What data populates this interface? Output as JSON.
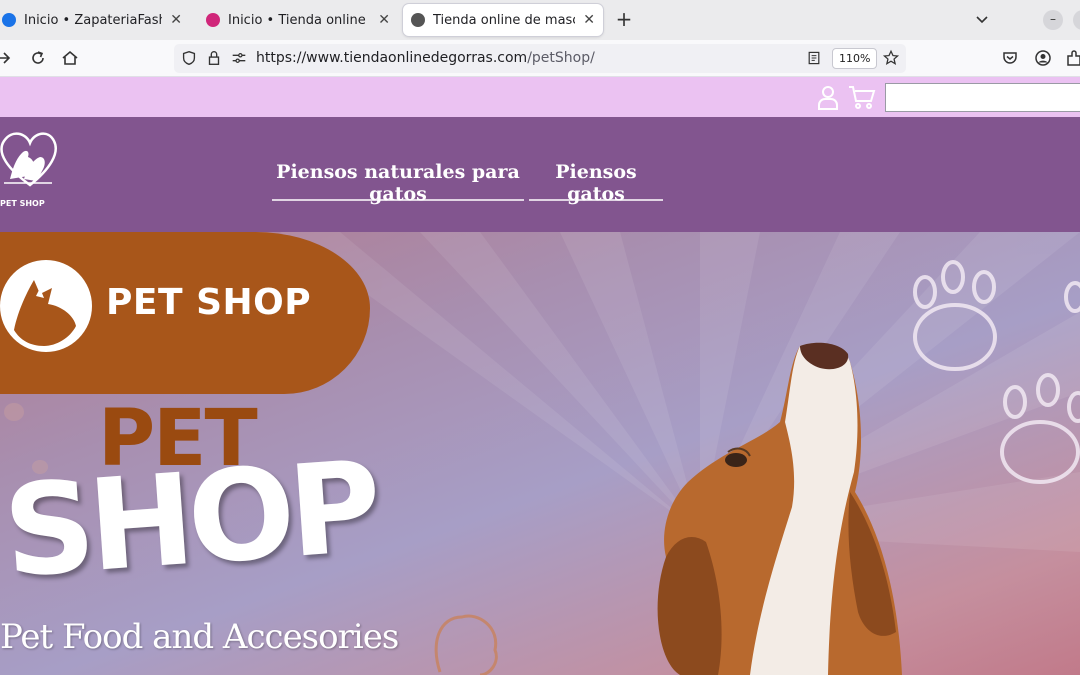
{
  "browser": {
    "tabs": [
      {
        "title": "Inicio • ZapateriaFashion",
        "favicon_color": "#1a73e8",
        "active": false
      },
      {
        "title": "Inicio • Tienda online de m",
        "favicon_color": "#d0267a",
        "active": false
      },
      {
        "title": "Tienda online de mascota",
        "favicon_color": "#555555",
        "active": true
      }
    ],
    "new_tab_label": "+",
    "url_host": "https://www.tiendaonlinedegorras.com",
    "url_path": "/petShop/",
    "zoom": "110%"
  },
  "site": {
    "logo_text": "PET SHOP",
    "menu": [
      {
        "label": "Piensos naturales para gatos"
      },
      {
        "label": "Piensos gatos"
      }
    ],
    "search_placeholder": ""
  },
  "hero": {
    "badge_text": "PET SHOP",
    "headline_top": "PET",
    "headline_main": "SHOP",
    "tagline": "Pet Food and Accesories"
  },
  "colors": {
    "topbar": "#ebc2f2",
    "header": "#82558f",
    "badge": "#a8561a"
  }
}
